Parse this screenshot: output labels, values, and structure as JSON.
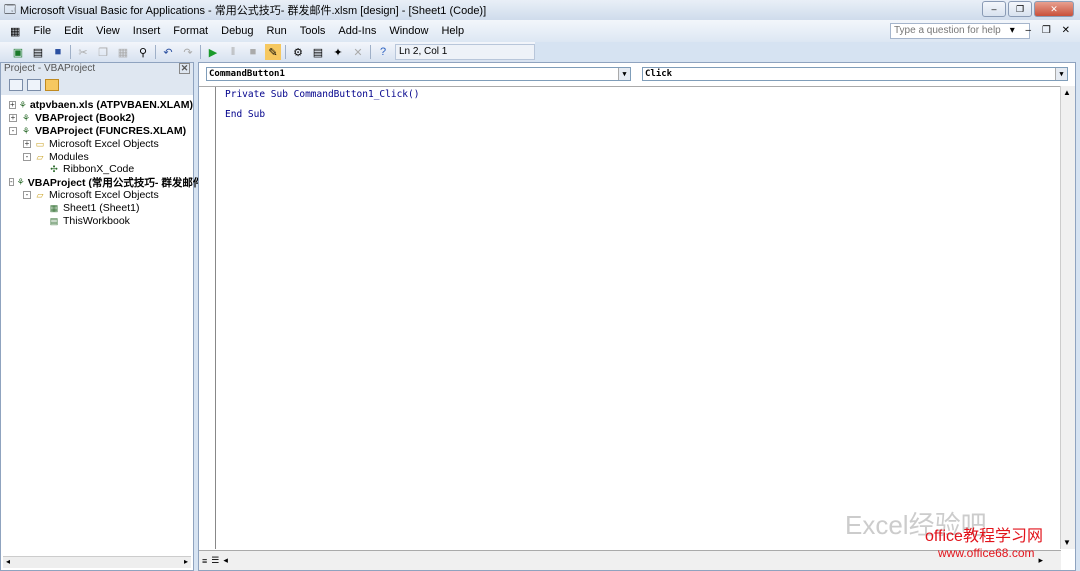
{
  "window": {
    "title": "Microsoft Visual Basic for Applications - 常用公式技巧- 群发邮件.xlsm [design] - [Sheet1 (Code)]"
  },
  "menu": [
    "File",
    "Edit",
    "View",
    "Insert",
    "Format",
    "Debug",
    "Run",
    "Tools",
    "Add-Ins",
    "Window",
    "Help"
  ],
  "help_placeholder": "Type a question for help",
  "toolbar": {
    "position": "Ln 2, Col 1"
  },
  "project": {
    "title": "Project - VBAProject",
    "tree": [
      {
        "label": "atpvbaen.xls (ATPVBAEN.XLAM)",
        "level": 0,
        "bold": true,
        "exp": "+",
        "icon": "vba-project-icon"
      },
      {
        "label": "VBAProject (Book2)",
        "level": 0,
        "bold": true,
        "exp": "+",
        "icon": "vba-project-icon"
      },
      {
        "label": "VBAProject (FUNCRES.XLAM)",
        "level": 0,
        "bold": true,
        "exp": "-",
        "icon": "vba-project-icon"
      },
      {
        "label": "Microsoft Excel Objects",
        "level": 1,
        "exp": "+",
        "icon": "folder-icon"
      },
      {
        "label": "Modules",
        "level": 1,
        "exp": "-",
        "icon": "folder-open-icon"
      },
      {
        "label": "RibbonX_Code",
        "level": 2,
        "icon": "module-icon"
      },
      {
        "label": "VBAProject (常用公式技巧- 群发邮件.xlsm)",
        "level": 0,
        "bold": true,
        "exp": "-",
        "icon": "vba-project-icon"
      },
      {
        "label": "Microsoft Excel Objects",
        "level": 1,
        "exp": "-",
        "icon": "folder-open-icon"
      },
      {
        "label": "Sheet1 (Sheet1)",
        "level": 2,
        "icon": "sheet-icon"
      },
      {
        "label": "ThisWorkbook",
        "level": 2,
        "icon": "workbook-icon"
      }
    ]
  },
  "code": {
    "object": "CommandButton1",
    "procedure": "Click",
    "lines": [
      "Private Sub CommandButton1_Click()",
      "",
      "End Sub"
    ]
  },
  "watermark": {
    "a": "Excel经验吧",
    "b": "office教程学习网",
    "c": "www.office68.com"
  }
}
